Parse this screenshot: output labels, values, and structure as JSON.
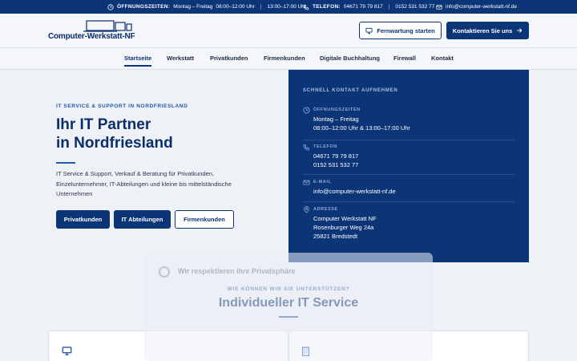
{
  "topbar": {
    "hours_label": "ÖFFNUNGSZEITEN:",
    "hours_days": "Montag – Freitag",
    "hours_morning": "08:00–12:00 Uhr",
    "hours_sep": "|",
    "hours_afternoon": "13:00–17:00 Uhr",
    "phone_label": "TELEFON:",
    "phone_1": "04671 79 79 817",
    "phone_sep": "|",
    "phone_2": "0152 531 532 77",
    "email": "info@computer-werkstatt-nf.de",
    "icons": [
      "clock-icon",
      "phone-icon",
      "mail-icon"
    ]
  },
  "header": {
    "logo_text": "Computer-Werkstatt-NF",
    "remote_button": "Fernwartung starten",
    "contact_button": "Kontaktieren Sie uns"
  },
  "nav": {
    "items": [
      "Startseite",
      "Werkstatt",
      "Privatkunden",
      "Firmenkunden",
      "Digitale Buchhaltung",
      "Firewall",
      "Kontakt"
    ],
    "active": "Startseite"
  },
  "hero": {
    "eyebrow": "IT SERVICE & SUPPORT IN NORDFRIESLAND",
    "title_line1": "Ihr IT Partner",
    "title_line2": "in Nordfriesland",
    "description": "IT Service & Support, Verkauf & Beratung für Privatkunden, Einzelunternehmer, IT-Abteilungen und kleine bis mittelständische Unternehmen",
    "buttons": [
      "Privatkunden",
      "IT Abteilungen",
      "Firmenkunden"
    ]
  },
  "contact": {
    "heading": "SCHNELL KONTAKT AUFNEHMEN",
    "hours_label": "ÖFFNUNGSZEITEN",
    "hours_line1": "Montag – Freitag",
    "hours_line2": "08:00–12:00 Uhr & 13:00–17:00 Uhr",
    "phone_label": "TELEFON",
    "phone_1": "04671 79 79 817",
    "phone_2": "0152 531 532 77",
    "email_label": "E-MAIL",
    "email": "info@computer-werkstatt-nf.de",
    "address_label": "ADRESSE",
    "address_1": "Computer Werkstatt NF",
    "address_2": "Rosenburger Weg 24a",
    "address_3": "25821 Bredstedt"
  },
  "services": {
    "eyebrow": "WIE KÖNNEN WIR SIE UNTERSTÜTZEN?",
    "title": "Individueller IT Service",
    "card_icons": [
      "monitor-icon",
      "building-icon"
    ]
  },
  "cookie": {
    "title": "Wir respektieren Ihre Privatsphäre"
  },
  "colors": {
    "primary": "#0c3578",
    "accent": "#2357a8",
    "background": "#eef1f6"
  }
}
